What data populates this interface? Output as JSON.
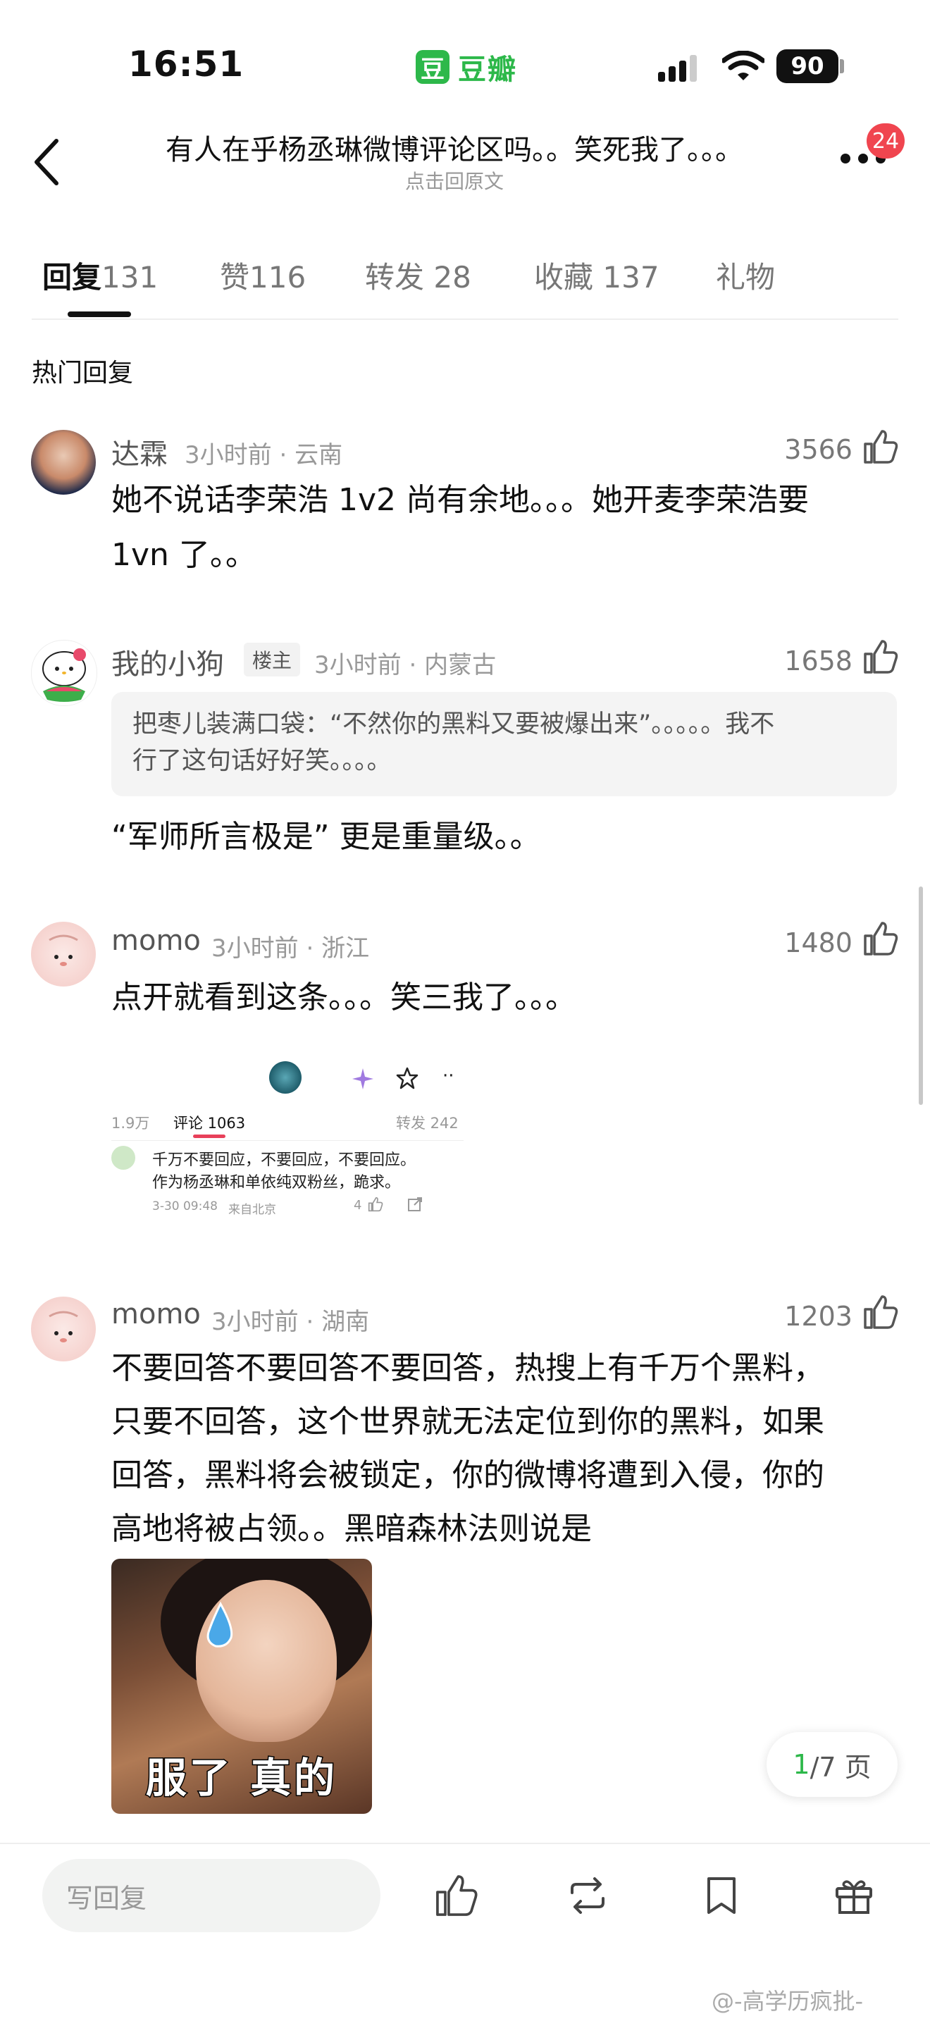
{
  "status_bar": {
    "time": "16:51",
    "app_name": "豆瓣",
    "app_mark": "豆",
    "battery": "90"
  },
  "nav": {
    "title": "有人在乎杨丞琳微博评论区吗。。笑死我了。。。",
    "subtitle": "点击回原文",
    "badge": "24"
  },
  "tabs": [
    {
      "label": "回复",
      "count": "131",
      "active": true
    },
    {
      "label": "赞",
      "count": "116"
    },
    {
      "label": "转发",
      "count": "28"
    },
    {
      "label": "收藏",
      "count": "137"
    },
    {
      "label": "礼物",
      "count": ""
    }
  ],
  "section_title": "热门回复",
  "comments": [
    {
      "user": "达霖",
      "time": "3小时前",
      "location": "云南",
      "likes": "3566",
      "text_lines": [
        "她不说话李荣浩 1v2 尚有余地。。。她开麦李荣浩要",
        "1vn 了。。"
      ]
    },
    {
      "user": "我的小狗",
      "tag": "楼主",
      "time": "3小时前",
      "location": "内蒙古",
      "likes": "1658",
      "quote_lines": [
        "把枣儿装满口袋：“不然你的黑料又要被爆出来”。。。。。我不",
        "行了这句话好好笑。。。。"
      ],
      "text_lines": [
        "“军师所言极是” 更是重量级。。"
      ]
    },
    {
      "user": "momo",
      "time": "3小时前",
      "location": "浙江",
      "likes": "1480",
      "text_lines": [
        "点开就看到这条。。。笑三我了。。。"
      ],
      "embedded": {
        "left_count": "1.9万",
        "comment_tab": "评论 1063",
        "repost": "转发 242",
        "text_lines": [
          "千万不要回应，不要回应，不要回应。",
          "作为杨丞琳和单依纯双粉丝，跪求。"
        ],
        "date": "3-30 09:48",
        "source": "来自北京",
        "likes": "4"
      }
    },
    {
      "user": "momo",
      "time": "3小时前",
      "location": "湖南",
      "likes": "1203",
      "text_lines": [
        "不要回答不要回答不要回答，热搜上有千万个黑料，",
        "只要不回答，这个世界就无法定位到你的黑料，如果",
        "回答，黑料将会被锁定，你的微博将遭到入侵，你的",
        "高地将被占领。。黑暗森林法则说是"
      ],
      "meme_caption": "服了 真的"
    }
  ],
  "pager": {
    "current": "1",
    "total_text": "/7 页"
  },
  "bottom_bar": {
    "reply_placeholder": "写回复"
  },
  "watermark": "@-高学历疯批-",
  "colors": {
    "accent": "#2db84a",
    "badge": "#f0454f",
    "text": "#111111",
    "muted": "#999999"
  },
  "icons": [
    "back-icon",
    "more-icon",
    "thumb-up-icon",
    "repost-icon",
    "bookmark-icon",
    "gift-icon",
    "signal-icon",
    "wifi-icon"
  ]
}
